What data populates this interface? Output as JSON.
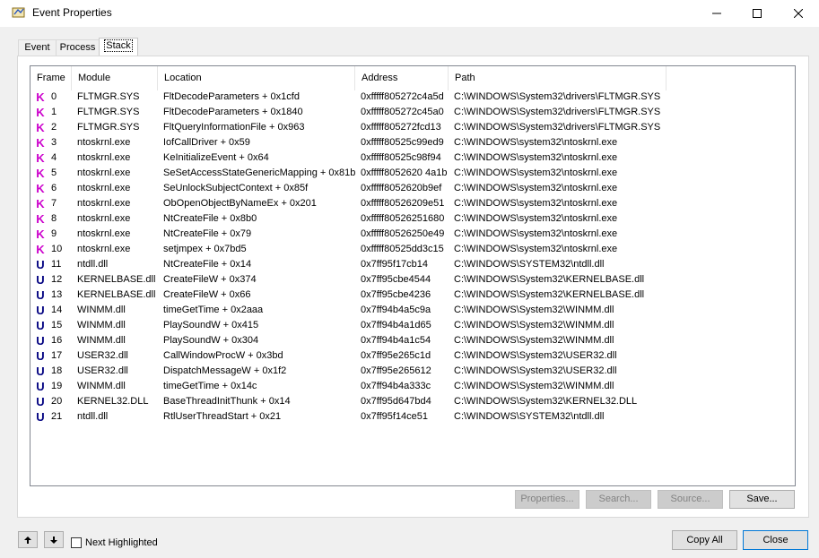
{
  "window": {
    "title": "Event Properties"
  },
  "tabs": [
    "Event",
    "Process",
    "Stack"
  ],
  "columns": [
    "Frame",
    "Module",
    "Location",
    "Address",
    "Path"
  ],
  "colors": {
    "kernel": "#cc00cc",
    "user": "#000080"
  },
  "rows": [
    {
      "type": "K",
      "frame": "0",
      "module": "FLTMGR.SYS",
      "location": "FltDecodeParameters + 0x1cfd",
      "address": "0xfffff805272c4a5d",
      "path": "C:\\WINDOWS\\System32\\drivers\\FLTMGR.SYS"
    },
    {
      "type": "K",
      "frame": "1",
      "module": "FLTMGR.SYS",
      "location": "FltDecodeParameters + 0x1840",
      "address": "0xfffff805272c45a0",
      "path": "C:\\WINDOWS\\System32\\drivers\\FLTMGR.SYS"
    },
    {
      "type": "K",
      "frame": "2",
      "module": "FLTMGR.SYS",
      "location": "FltQueryInformationFile + 0x963",
      "address": "0xfffff805272fcd13",
      "path": "C:\\WINDOWS\\System32\\drivers\\FLTMGR.SYS"
    },
    {
      "type": "K",
      "frame": "3",
      "module": "ntoskrnl.exe",
      "location": "IofCallDriver + 0x59",
      "address": "0xfffff80525c99ed9",
      "path": "C:\\WINDOWS\\system32\\ntoskrnl.exe"
    },
    {
      "type": "K",
      "frame": "4",
      "module": "ntoskrnl.exe",
      "location": "KeInitializeEvent + 0x64",
      "address": "0xfffff80525c98f94",
      "path": "C:\\WINDOWS\\system32\\ntoskrnl.exe"
    },
    {
      "type": "K",
      "frame": "5",
      "module": "ntoskrnl.exe",
      "location": "SeSetAccessStateGenericMapping + 0x81b",
      "address": "0xfffff8052620 4a1b",
      "path": "C:\\WINDOWS\\system32\\ntoskrnl.exe"
    },
    {
      "type": "K",
      "frame": "6",
      "module": "ntoskrnl.exe",
      "location": "SeUnlockSubjectContext + 0x85f",
      "address": "0xfffff8052620b9ef",
      "path": "C:\\WINDOWS\\system32\\ntoskrnl.exe"
    },
    {
      "type": "K",
      "frame": "7",
      "module": "ntoskrnl.exe",
      "location": "ObOpenObjectByNameEx + 0x201",
      "address": "0xfffff80526209e51",
      "path": "C:\\WINDOWS\\system32\\ntoskrnl.exe"
    },
    {
      "type": "K",
      "frame": "8",
      "module": "ntoskrnl.exe",
      "location": "NtCreateFile + 0x8b0",
      "address": "0xfffff80526251680",
      "path": "C:\\WINDOWS\\system32\\ntoskrnl.exe"
    },
    {
      "type": "K",
      "frame": "9",
      "module": "ntoskrnl.exe",
      "location": "NtCreateFile + 0x79",
      "address": "0xfffff80526250e49",
      "path": "C:\\WINDOWS\\system32\\ntoskrnl.exe"
    },
    {
      "type": "K",
      "frame": "10",
      "module": "ntoskrnl.exe",
      "location": "setjmpex + 0x7bd5",
      "address": "0xfffff80525dd3c15",
      "path": "C:\\WINDOWS\\system32\\ntoskrnl.exe"
    },
    {
      "type": "U",
      "frame": "11",
      "module": "ntdll.dll",
      "location": "NtCreateFile + 0x14",
      "address": "0x7ff95f17cb14",
      "path": "C:\\WINDOWS\\SYSTEM32\\ntdll.dll"
    },
    {
      "type": "U",
      "frame": "12",
      "module": "KERNELBASE.dll",
      "location": "CreateFileW + 0x374",
      "address": "0x7ff95cbe4544",
      "path": "C:\\WINDOWS\\System32\\KERNELBASE.dll"
    },
    {
      "type": "U",
      "frame": "13",
      "module": "KERNELBASE.dll",
      "location": "CreateFileW + 0x66",
      "address": "0x7ff95cbe4236",
      "path": "C:\\WINDOWS\\System32\\KERNELBASE.dll"
    },
    {
      "type": "U",
      "frame": "14",
      "module": "WINMM.dll",
      "location": "timeGetTime + 0x2aaa",
      "address": "0x7ff94b4a5c9a",
      "path": "C:\\WINDOWS\\System32\\WINMM.dll"
    },
    {
      "type": "U",
      "frame": "15",
      "module": "WINMM.dll",
      "location": "PlaySoundW + 0x415",
      "address": "0x7ff94b4a1d65",
      "path": "C:\\WINDOWS\\System32\\WINMM.dll"
    },
    {
      "type": "U",
      "frame": "16",
      "module": "WINMM.dll",
      "location": "PlaySoundW + 0x304",
      "address": "0x7ff94b4a1c54",
      "path": "C:\\WINDOWS\\System32\\WINMM.dll"
    },
    {
      "type": "U",
      "frame": "17",
      "module": "USER32.dll",
      "location": "CallWindowProcW + 0x3bd",
      "address": "0x7ff95e265c1d",
      "path": "C:\\WINDOWS\\System32\\USER32.dll"
    },
    {
      "type": "U",
      "frame": "18",
      "module": "USER32.dll",
      "location": "DispatchMessageW + 0x1f2",
      "address": "0x7ff95e265612",
      "path": "C:\\WINDOWS\\System32\\USER32.dll"
    },
    {
      "type": "U",
      "frame": "19",
      "module": "WINMM.dll",
      "location": "timeGetTime + 0x14c",
      "address": "0x7ff94b4a333c",
      "path": "C:\\WINDOWS\\System32\\WINMM.dll"
    },
    {
      "type": "U",
      "frame": "20",
      "module": "KERNEL32.DLL",
      "location": "BaseThreadInitThunk + 0x14",
      "address": "0x7ff95d647bd4",
      "path": "C:\\WINDOWS\\System32\\KERNEL32.DLL"
    },
    {
      "type": "U",
      "frame": "21",
      "module": "ntdll.dll",
      "location": "RtlUserThreadStart + 0x21",
      "address": "0x7ff95f14ce51",
      "path": "C:\\WINDOWS\\SYSTEM32\\ntdll.dll"
    }
  ],
  "buttons": {
    "properties": "Properties...",
    "search": "Search...",
    "source": "Source...",
    "save": "Save...",
    "copy_all": "Copy All",
    "close": "Close"
  },
  "next_highlighted": "Next Highlighted"
}
